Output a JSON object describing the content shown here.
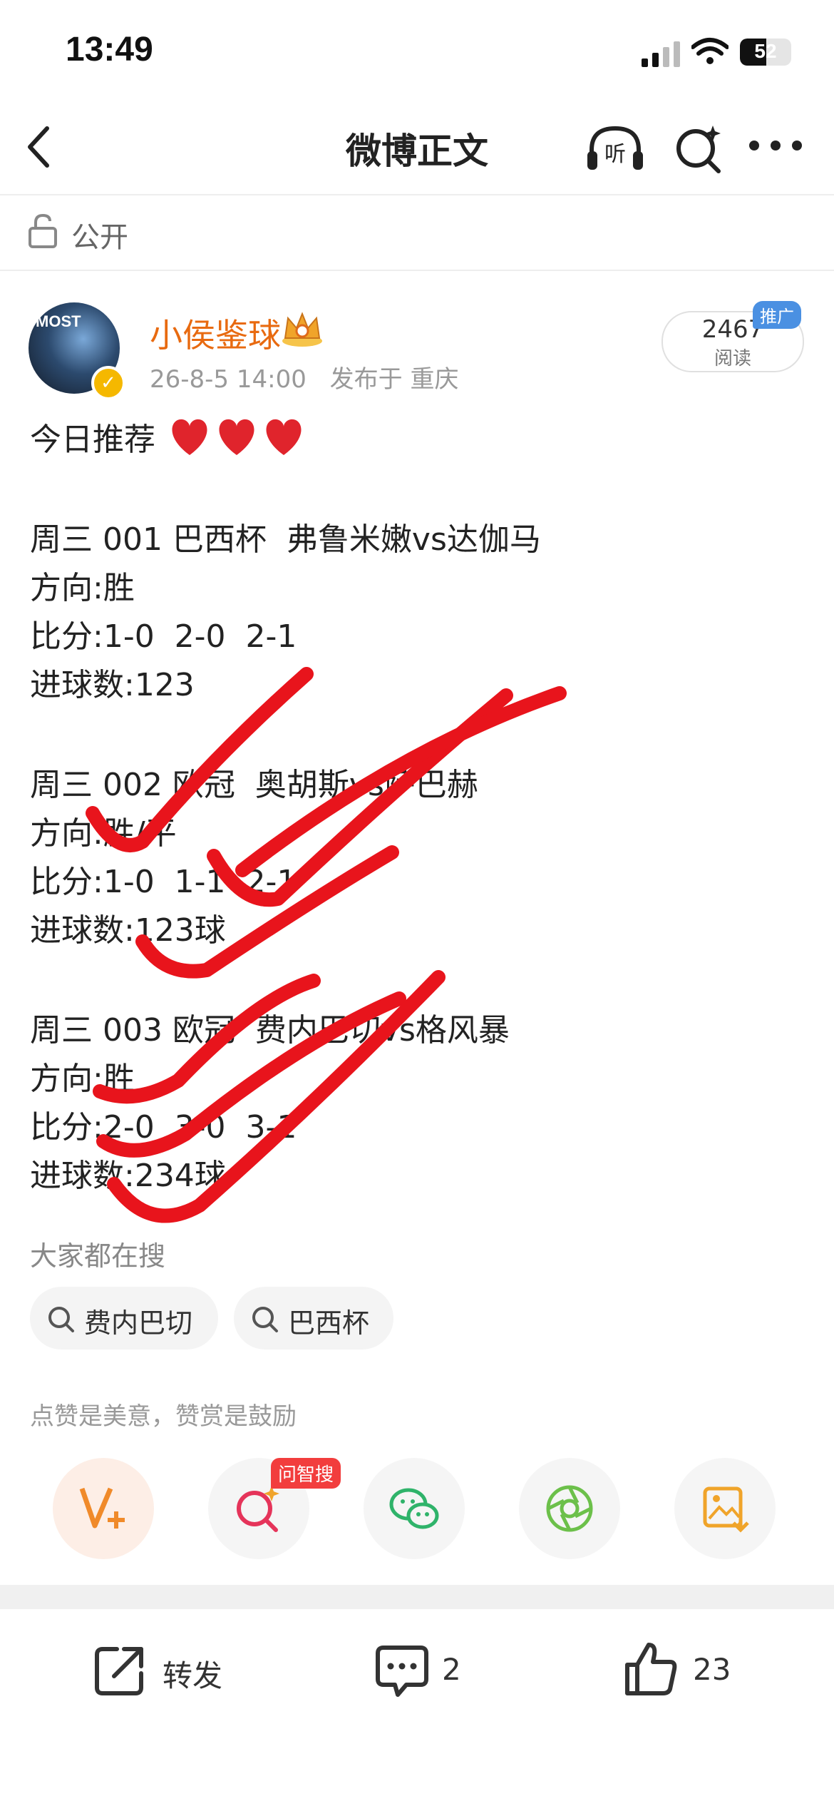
{
  "status_bar": {
    "time": "13:49",
    "battery": "52"
  },
  "header": {
    "title": "微博正文"
  },
  "visibility": {
    "label": "公开"
  },
  "author": {
    "name": "小侯鉴球",
    "avatar_text": "MOST",
    "post_time": "26-8-5 14:00",
    "location": "发布于 重庆"
  },
  "read_stats": {
    "count": "2467",
    "label": "阅读",
    "promo_tag": "推广"
  },
  "post": {
    "lines": [
      "今日推荐",
      "周三 001 巴西杯  弗鲁米嫩vs达伽马",
      "方向:胜",
      "比分:1-0  2-0  2-1",
      "进球数:123",
      "周三 002 欧冠  奥胡斯vs萨巴赫",
      "方向:胜/平",
      "比分:1-0  1-1  2-1",
      "进球数:123球",
      "周三 003 欧冠  费内巴切vs格风暴",
      "方向:胜",
      "比分:2-0  3-0  3-1",
      "进球数:234球"
    ]
  },
  "search": {
    "heading": "大家都在搜",
    "chips": [
      "费内巴切",
      "巴西杯"
    ]
  },
  "encourage_text": "点赞是美意，赞赏是鼓励",
  "actions": {
    "ask_badge": "问智搜",
    "icons": [
      "vplus-icon",
      "ai-search-icon",
      "wechat-icon",
      "moments-icon",
      "save-image-icon"
    ]
  },
  "bottom_bar": {
    "repost_label": "转发",
    "comment_count": "2",
    "like_count": "23"
  },
  "colors": {
    "author_name": "#e86a10",
    "checkmark_overlay": "#e8141c",
    "promo_tag": "#4a90e2",
    "ask_badge": "#f23d3d"
  }
}
